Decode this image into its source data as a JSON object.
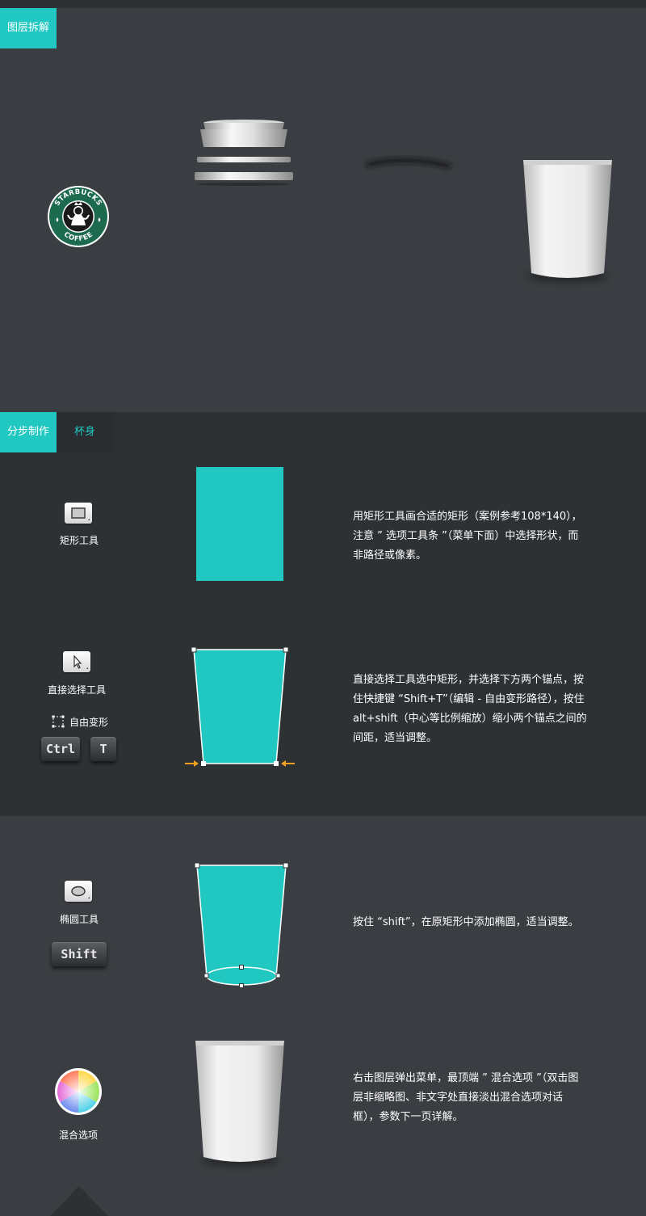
{
  "section1": {
    "tag": "图层拆解"
  },
  "logo": {
    "top_text": "STARBUCKS",
    "bottom_text": "COFFEE",
    "color": "#1d6b4e"
  },
  "section2": {
    "tag": "分步制作",
    "subtag": "杯身"
  },
  "steps": [
    {
      "tool_label": "矩形工具",
      "icon": "rectangle-tool-icon",
      "desc": "用矩形工具画合适的矩形（案例参考108*140），注意 ” 选项工具条 ”（菜单下面）中选择形状，而非路径或像素。"
    },
    {
      "tool_label": "直接选择工具",
      "icon": "direct-select-arrow-icon",
      "transform_label": "自由变形",
      "key1": "Ctrl",
      "key2": "T",
      "desc": "直接选择工具选中矩形，并选择下方两个锚点，按住快捷键 “Shift+T”（编辑 - 自由变形路径），按住 alt+shift（中心等比例缩放）缩小两个锚点之间的间距，适当调整。"
    },
    {
      "tool_label": "椭圆工具",
      "icon": "ellipse-tool-icon",
      "key": "Shift",
      "desc": "按住 “shift”，在原矩形中添加椭圆，适当调整。"
    },
    {
      "tool_label": "混合选项",
      "icon": "color-wheel-icon",
      "desc": "右击图层弹出菜单，最顶端 ” 混合选项 ”（双击图层非缩略图、非文字处直接淡出混合选项对话框），参数下一页详解。"
    }
  ],
  "colors": {
    "accent": "#21c7c1",
    "arrow": "#f0a020",
    "bg_dark": "#2e3134",
    "bg_mid": "#3a3d41"
  }
}
